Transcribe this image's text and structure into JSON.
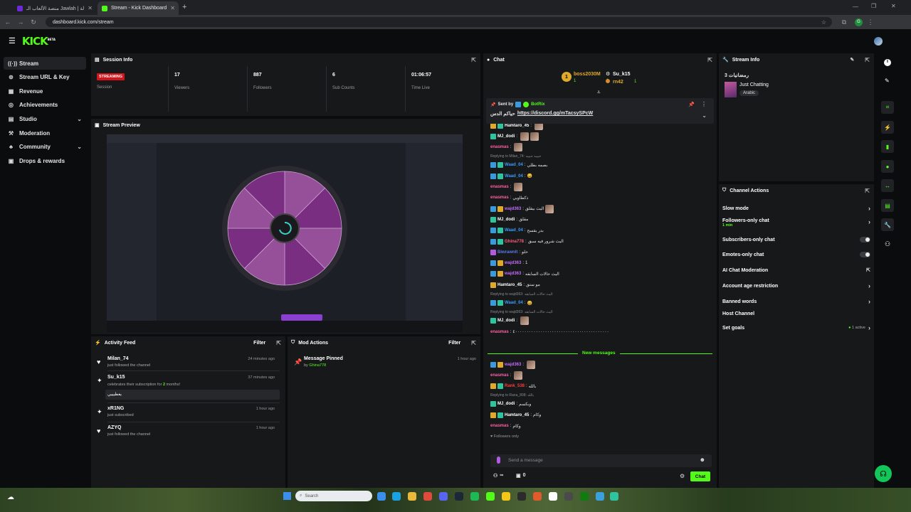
{
  "browser": {
    "tabs": [
      {
        "title": "منصة الألعاب الـ Jawlah | جولة"
      },
      {
        "title": "Stream - Kick Dashboard"
      }
    ],
    "url": "dashboard.kick.com/stream",
    "profile_initial": "G"
  },
  "logo": {
    "text": "KICK",
    "badge": "BETA"
  },
  "sidebar": {
    "items": [
      {
        "label": "Stream",
        "icon": "stream-icon"
      },
      {
        "label": "Stream URL & Key",
        "icon": "key-icon"
      },
      {
        "label": "Revenue",
        "icon": "revenue-icon"
      },
      {
        "label": "Achievements",
        "icon": "achievements-icon"
      },
      {
        "label": "Studio",
        "icon": "studio-icon"
      },
      {
        "label": "Moderation",
        "icon": "moderation-icon"
      },
      {
        "label": "Community",
        "icon": "community-icon"
      },
      {
        "label": "Drops & rewards",
        "icon": "gift-icon"
      }
    ]
  },
  "session": {
    "title": "Session Info",
    "badge": "STREAMING",
    "stats": [
      {
        "label": "Session",
        "value": ""
      },
      {
        "label": "Viewers",
        "value": "17"
      },
      {
        "label": "Followers",
        "value": "887"
      },
      {
        "label": "Sub Counts",
        "value": "6"
      },
      {
        "label": "Time Live",
        "value": "01:06:57"
      }
    ]
  },
  "preview": {
    "title": "Stream Preview"
  },
  "activity": {
    "title": "Activity Feed",
    "filter": "Filter",
    "items": [
      {
        "name": "Milan_74",
        "text": "just followed the channel",
        "time": "24 minutes ago",
        "icon": "heart-icon"
      },
      {
        "name": "Su_k15",
        "text_pre": "celebrates their subscription for ",
        "months": "2",
        "text_post": " months!",
        "time": "37 minutes ago",
        "message": "يعطيييي",
        "icon": "star-icon"
      },
      {
        "name": "xR1NG",
        "text": "just subscribed",
        "time": "1 hour ago",
        "icon": "star-icon"
      },
      {
        "name": "AZYQ",
        "text": "just followed the channel",
        "time": "1 hour ago",
        "icon": "heart-icon"
      }
    ]
  },
  "modactions": {
    "title": "Mod Actions",
    "filter": "Filter",
    "items": [
      {
        "title": "Message Pinned",
        "by": "by",
        "user": "Ghina778",
        "time": "1 hour ago"
      }
    ]
  },
  "chat": {
    "title": "Chat",
    "leaderboard": [
      {
        "rank": "1",
        "name": "boss2030M",
        "score": "1"
      },
      {
        "rank": "2",
        "name": "Su_k15",
        "score": "1"
      },
      {
        "rank": "3",
        "name": "rn42",
        "score": "1"
      }
    ],
    "pinned": {
      "sent_by": "Sent by",
      "bot": "BotRix",
      "text": "حياكم الدس",
      "link": "https://discord.gg/mTacsySPcW"
    },
    "messages": [
      {
        "user": "Hamtaro_45",
        "color": "#ffffff",
        "text": "",
        "badges": [
          "bg",
          "bt"
        ],
        "emotes": 1
      },
      {
        "user": "MJ_dodi",
        "color": "#ffffff",
        "text": "",
        "badges": [
          "bt"
        ],
        "emotes": 2
      },
      {
        "user": "enasmas",
        "color": "#ff5fa2",
        "text": "",
        "badges": [],
        "emotes": 1
      },
      {
        "user": "Waad_04",
        "color": "#3b9bff",
        "text": "بصمه بطلي",
        "badges": [
          "bb",
          "bt"
        ],
        "emotes": 0,
        "reply": "Replying to Milan_74: حبيبه حبيبه"
      },
      {
        "user": "Waad_04",
        "color": "#3b9bff",
        "text": "😀",
        "badges": [
          "bb",
          "bt"
        ],
        "emotes": 0
      },
      {
        "user": "enasmas",
        "color": "#ff5fa2",
        "text": "",
        "badges": [],
        "emotes": 1
      },
      {
        "user": "enasmas",
        "color": "#ff5fa2",
        "text": "ذكطاويي",
        "badges": [],
        "emotes": 0
      },
      {
        "user": "wajd363",
        "color": "#c46bff",
        "text": "اليث بيقلق",
        "badges": [
          "bb",
          "bg"
        ],
        "emotes": 1
      },
      {
        "user": "MJ_dodi",
        "color": "#ffffff",
        "text": "مقلق",
        "badges": [
          "bt"
        ],
        "emotes": 0
      },
      {
        "user": "Waad_04",
        "color": "#3b9bff",
        "text": "بدر يقسح",
        "badges": [
          "bb",
          "bt"
        ],
        "emotes": 0
      },
      {
        "user": "Ghina778",
        "color": "#ff5f7a",
        "text": "اليث شرور فيه سبق",
        "badges": [
          "bb",
          "bt"
        ],
        "emotes": 0
      },
      {
        "user": "Biwrawnlt",
        "color": "#5b78e8",
        "text": "حلو",
        "badges": [
          "bp"
        ],
        "emotes": 0
      },
      {
        "user": "wajd363",
        "color": "#c46bff",
        "text": "1",
        "badges": [
          "bb",
          "bg"
        ],
        "emotes": 0
      },
      {
        "user": "wajd363",
        "color": "#c46bff",
        "text": "اليث حالات السابقه",
        "badges": [
          "bb",
          "bg"
        ],
        "emotes": 0
      },
      {
        "user": "Hamtaro_45",
        "color": "#ffffff",
        "text": "مو ستق",
        "badges": [
          "bg"
        ],
        "emotes": 0
      },
      {
        "user": "Waad_04",
        "color": "#3b9bff",
        "text": "😀",
        "badges": [
          "bb",
          "bt"
        ],
        "emotes": 0,
        "reply": "Replying to wajd363: اليث حالات السابقه"
      },
      {
        "user": "MJ_dodi",
        "color": "#ffffff",
        "text": "",
        "badges": [
          "bt"
        ],
        "emotes": 1,
        "reply": "Replying to wajd363: اليث حالات السابقه"
      },
      {
        "user": "enasmas",
        "color": "#ff5fa2",
        "text": "٤٠٠٠٠٠٠٠٠٠٠٠٠٠٠٠٠٠٠٠٠٠٠٠٠٠٠٠٠٠٠٠٠٠٠٠٠٠٠٠٠٠",
        "badges": [],
        "emotes": 0
      }
    ],
    "new_messages": "New messages",
    "new": [
      {
        "user": "wajd363",
        "color": "#c46bff",
        "text": "",
        "badges": [
          "bb",
          "bg"
        ],
        "emotes": 1
      },
      {
        "user": "enasmas",
        "color": "#ff5fa2",
        "text": "",
        "badges": [],
        "emotes": 1
      },
      {
        "user": "Rank_538",
        "color": "#ff3b3b",
        "text": "بالله",
        "badges": [
          "bg",
          "bt"
        ],
        "emotes": 0
      },
      {
        "user": "MJ_dodi",
        "color": "#ffffff",
        "text": "وبكسم",
        "badges": [
          "bt"
        ],
        "emotes": 0,
        "reply": "Replying to Rana_808: بالله"
      },
      {
        "user": "Hamtaro_45",
        "color": "#ffffff",
        "text": "وكام",
        "badges": [
          "bg",
          "bt"
        ],
        "emotes": 0
      },
      {
        "user": "enasmas",
        "color": "#ff5fa2",
        "text": "وكام",
        "badges": [],
        "emotes": 0
      }
    ],
    "followers_only": "Followers only",
    "placeholder": "Send a message",
    "viewer_count": "∞",
    "points": "0",
    "chat_button": "Chat"
  },
  "stream_info": {
    "title": "Stream Info",
    "stream_title": "رمضانيات 3",
    "category": "Just Chatting",
    "language": "Arabic"
  },
  "channel_actions": {
    "title": "Channel Actions",
    "items": [
      {
        "label": "Slow mode",
        "type": "chevron"
      },
      {
        "label": "Followers-only chat",
        "sub": "1 min",
        "type": "chevron"
      },
      {
        "label": "Subscribers-only chat",
        "type": "toggle"
      },
      {
        "label": "Emotes-only chat",
        "type": "toggle"
      },
      {
        "label": "AI Chat Moderation",
        "type": "popout"
      },
      {
        "label": "Account age restriction",
        "type": "chevron"
      },
      {
        "label": "Banned words",
        "type": "chevron"
      },
      {
        "label": "Host Channel",
        "type": "none"
      },
      {
        "label": "Set goals",
        "type": "goals",
        "value": "1 active"
      }
    ]
  },
  "taskbar": {
    "search": "Search"
  },
  "colors": {
    "accent": "#53fc18",
    "panel": "#17181a",
    "background": "#0b0c0d",
    "live_badge": "#d4141b"
  }
}
